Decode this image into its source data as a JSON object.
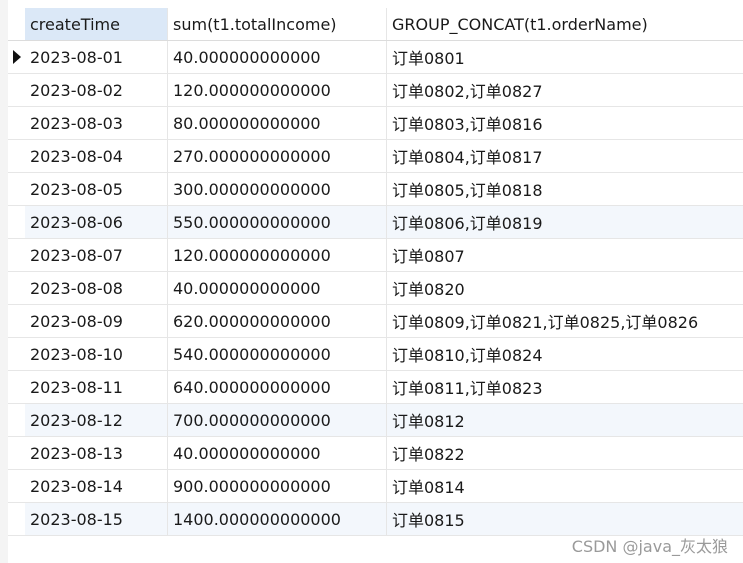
{
  "columns": [
    "createTime",
    "sum(t1.totalIncome)",
    "GROUP_CONCAT(t1.orderName)"
  ],
  "rows": [
    [
      "2023-08-01",
      "40.000000000000",
      "订单0801"
    ],
    [
      "2023-08-02",
      "120.000000000000",
      "订单0802,订单0827"
    ],
    [
      "2023-08-03",
      "80.000000000000",
      "订单0803,订单0816"
    ],
    [
      "2023-08-04",
      "270.000000000000",
      "订单0804,订单0817"
    ],
    [
      "2023-08-05",
      "300.000000000000",
      "订单0805,订单0818"
    ],
    [
      "2023-08-06",
      "550.000000000000",
      "订单0806,订单0819"
    ],
    [
      "2023-08-07",
      "120.000000000000",
      "订单0807"
    ],
    [
      "2023-08-08",
      "40.000000000000",
      "订单0820"
    ],
    [
      "2023-08-09",
      "620.000000000000",
      "订单0809,订单0821,订单0825,订单0826"
    ],
    [
      "2023-08-10",
      "540.000000000000",
      "订单0810,订单0824"
    ],
    [
      "2023-08-11",
      "640.000000000000",
      "订单0811,订单0823"
    ],
    [
      "2023-08-12",
      "700.000000000000",
      "订单0812"
    ],
    [
      "2023-08-13",
      "40.000000000000",
      "订单0822"
    ],
    [
      "2023-08-14",
      "900.000000000000",
      "订单0814"
    ],
    [
      "2023-08-15",
      "1400.000000000000",
      "订单0815"
    ]
  ],
  "watermark": "CSDN @java_灰太狼",
  "current_row_icon": "current-row-arrow-icon"
}
